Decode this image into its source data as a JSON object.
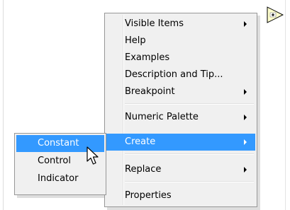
{
  "vi_node": {
    "icon": "plus-triangle-icon"
  },
  "context_menu": {
    "items": [
      {
        "label": "Visible Items",
        "has_submenu": true
      },
      {
        "label": "Help",
        "has_submenu": false
      },
      {
        "label": "Examples",
        "has_submenu": false
      },
      {
        "label": "Description and Tip...",
        "has_submenu": false
      },
      {
        "label": "Breakpoint",
        "has_submenu": true
      },
      {
        "label": "Numeric Palette",
        "has_submenu": true
      },
      {
        "label": "Create",
        "has_submenu": true,
        "highlighted": true
      },
      {
        "label": "Replace",
        "has_submenu": true
      },
      {
        "label": "Properties",
        "has_submenu": false
      }
    ]
  },
  "create_submenu": {
    "items": [
      {
        "label": "Constant",
        "highlighted": true
      },
      {
        "label": "Control",
        "highlighted": false
      },
      {
        "label": "Indicator",
        "highlighted": false
      }
    ]
  },
  "colors": {
    "highlight": "#3399ff",
    "menu_background": "#f0f0f0",
    "menu_border": "#979797",
    "node_fill": "#ffffcc"
  },
  "cursor": {
    "icon": "arrow-cursor-icon"
  }
}
